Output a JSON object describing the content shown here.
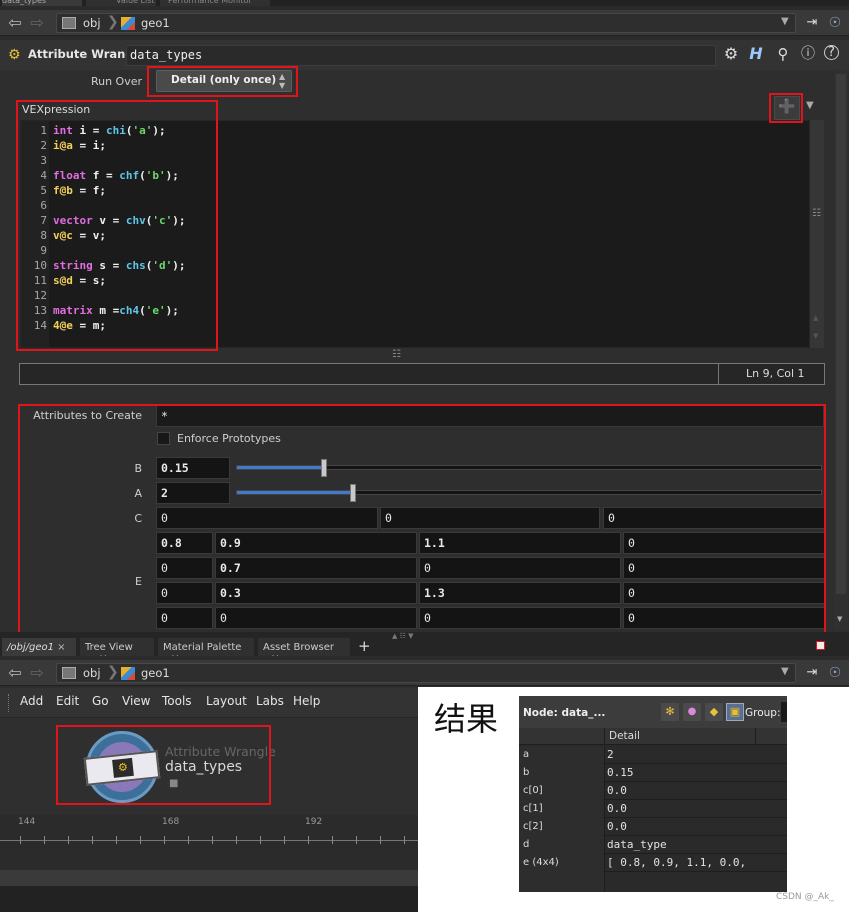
{
  "top_tabs": [
    "data_types",
    "Value List",
    "Performance Monitor"
  ],
  "nav_top": {
    "path_root": "obj",
    "path_node": "geo1"
  },
  "node": {
    "type_label": "Attribute Wrangle",
    "name": "data_types"
  },
  "run_over": {
    "label": "Run Over",
    "value": "Detail (only once)"
  },
  "vex": {
    "label": "VEXpression",
    "line_numbers": [
      "1",
      "2",
      "3",
      "4",
      "5",
      "6",
      "7",
      "8",
      "9",
      "10",
      "11",
      "12",
      "13",
      "14"
    ],
    "lines": [
      [
        {
          "t": "int",
          "c": "kw"
        },
        {
          "t": " i = ",
          "c": "plain"
        },
        {
          "t": "chi",
          "c": "fn"
        },
        {
          "t": "(",
          "c": "plain"
        },
        {
          "t": "'a'",
          "c": "str"
        },
        {
          "t": ");",
          "c": "plain"
        }
      ],
      [
        {
          "t": "i@a",
          "c": "var"
        },
        {
          "t": " = i;",
          "c": "plain"
        }
      ],
      [],
      [
        {
          "t": "float",
          "c": "kw"
        },
        {
          "t": " f = ",
          "c": "plain"
        },
        {
          "t": "chf",
          "c": "fn"
        },
        {
          "t": "(",
          "c": "plain"
        },
        {
          "t": "'b'",
          "c": "str"
        },
        {
          "t": ");",
          "c": "plain"
        }
      ],
      [
        {
          "t": "f@b",
          "c": "var"
        },
        {
          "t": " = f;",
          "c": "plain"
        }
      ],
      [],
      [
        {
          "t": "vector",
          "c": "kw"
        },
        {
          "t": " v = ",
          "c": "plain"
        },
        {
          "t": "chv",
          "c": "fn"
        },
        {
          "t": "(",
          "c": "plain"
        },
        {
          "t": "'c'",
          "c": "str"
        },
        {
          "t": ");",
          "c": "plain"
        }
      ],
      [
        {
          "t": "v@c",
          "c": "var"
        },
        {
          "t": " = v;",
          "c": "plain"
        }
      ],
      [],
      [
        {
          "t": "string",
          "c": "kw"
        },
        {
          "t": " s = ",
          "c": "plain"
        },
        {
          "t": "chs",
          "c": "fn"
        },
        {
          "t": "(",
          "c": "plain"
        },
        {
          "t": "'d'",
          "c": "str"
        },
        {
          "t": ");",
          "c": "plain"
        }
      ],
      [
        {
          "t": "s@d",
          "c": "var"
        },
        {
          "t": " = s;",
          "c": "plain"
        }
      ],
      [],
      [
        {
          "t": "matrix",
          "c": "kw"
        },
        {
          "t": " m =",
          "c": "plain"
        },
        {
          "t": "ch4",
          "c": "fn"
        },
        {
          "t": "(",
          "c": "plain"
        },
        {
          "t": "'e'",
          "c": "str"
        },
        {
          "t": ");",
          "c": "plain"
        }
      ],
      [
        {
          "t": "4@e",
          "c": "var"
        },
        {
          "t": " = m;",
          "c": "plain"
        }
      ]
    ],
    "status": "Ln 9, Col 1"
  },
  "params": {
    "attributes_to_create": {
      "label": "Attributes to Create",
      "value": "*"
    },
    "enforce_prototypes": {
      "label": "Enforce Prototypes",
      "checked": false
    },
    "b": {
      "label": "B",
      "value": "0.15",
      "slider_fraction": 0.15
    },
    "a": {
      "label": "A",
      "value": "2",
      "slider_fraction": 0.2
    },
    "c": {
      "label": "C",
      "values": [
        "0",
        "0",
        "0"
      ]
    },
    "e": {
      "label": "E",
      "rows": [
        [
          "0.8",
          "0.9",
          "1.1",
          "0"
        ],
        [
          "0",
          "0.7",
          "0",
          "0"
        ],
        [
          "0",
          "0.3",
          "1.3",
          "0"
        ],
        [
          "0",
          "0",
          "0",
          "0"
        ]
      ]
    }
  },
  "pane_tabs": [
    "/obj/geo1",
    "Tree View",
    "Material Palette",
    "Asset Browser"
  ],
  "nav_bottom": {
    "path_root": "obj",
    "path_node": "geo1"
  },
  "menu": [
    "Add",
    "Edit",
    "Go",
    "View",
    "Tools",
    "Layout",
    "Labs",
    "Help"
  ],
  "network_node": {
    "type_label": "Attribute Wrangle",
    "name": "data_types"
  },
  "timeline_ticks": [
    "144",
    "168",
    "192"
  ],
  "result_label": "结果",
  "spreadsheet": {
    "node_label": "Node: data_...",
    "group_label": "Group:",
    "column_header": "Detail",
    "rows": [
      {
        "k": "a",
        "v": "2"
      },
      {
        "k": "b",
        "v": "0.15"
      },
      {
        "k": "c[0]",
        "v": "0.0"
      },
      {
        "k": "c[1]",
        "v": "0.0"
      },
      {
        "k": "c[2]",
        "v": "0.0"
      },
      {
        "k": "d",
        "v": "data_type"
      },
      {
        "k": "e (4x4)",
        "v": "[ 0.8, 0.9, 1.1, 0.0,"
      }
    ]
  },
  "watermark": "CSDN @_Ak_"
}
